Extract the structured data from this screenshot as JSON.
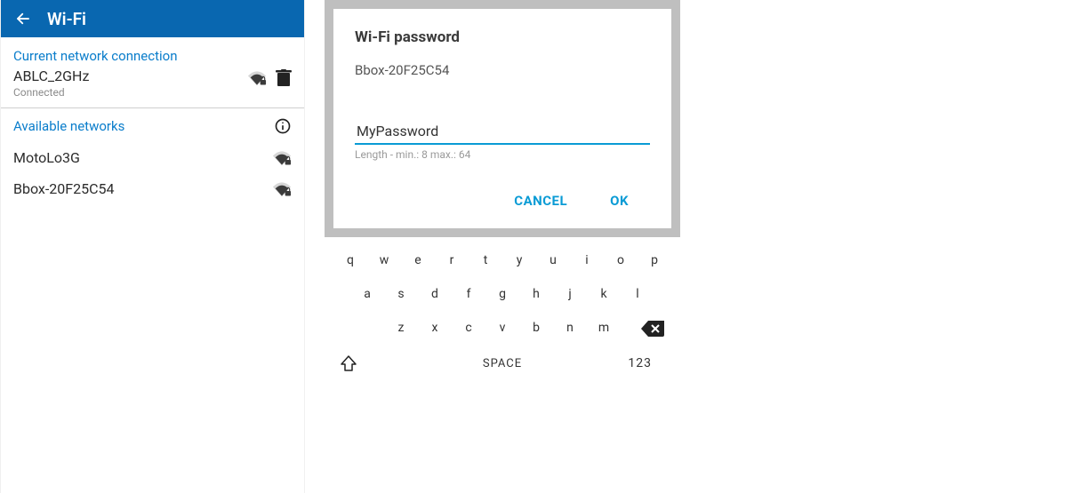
{
  "header": {
    "title": "Wi-Fi"
  },
  "current": {
    "section_label": "Current network connection",
    "name": "ABLC_2GHz",
    "status": "Connected"
  },
  "available": {
    "section_label": "Available networks",
    "items": [
      {
        "name": "MotoLo3G"
      },
      {
        "name": "Bbox-20F25C54"
      }
    ]
  },
  "password_dialog": {
    "title": "Wi-Fi password",
    "network": "Bbox-20F25C54",
    "value": "MyPassword",
    "hint": "Length - min.: 8 max.: 64",
    "cancel": "CANCEL",
    "ok": "OK"
  },
  "keyboard": {
    "row1": [
      "q",
      "w",
      "e",
      "r",
      "t",
      "y",
      "u",
      "i",
      "o",
      "p"
    ],
    "row2": [
      "a",
      "s",
      "d",
      "f",
      "g",
      "h",
      "j",
      "k",
      "l"
    ],
    "row3": [
      "z",
      "x",
      "c",
      "v",
      "b",
      "n",
      "m"
    ],
    "space": "SPACE",
    "numeric": "123"
  }
}
